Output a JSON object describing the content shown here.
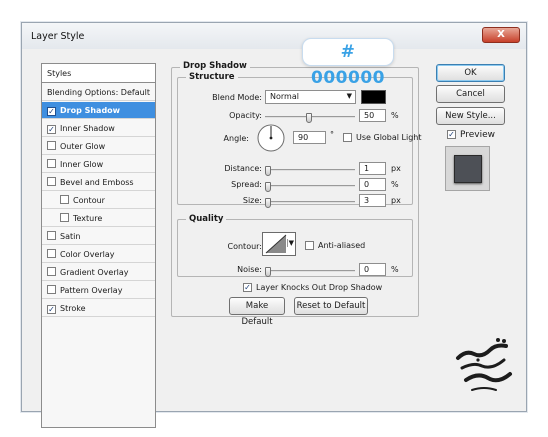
{
  "window": {
    "title": "Layer Style",
    "close_label": "X"
  },
  "color_tag": {
    "label": "# 000000"
  },
  "styles_panel": {
    "header": "Styles",
    "items": [
      {
        "label": "Blending Options: Default",
        "checkbox": false
      },
      {
        "label": "Drop Shadow",
        "checkbox": true,
        "checked": true,
        "active": true
      },
      {
        "label": "Inner Shadow",
        "checkbox": true,
        "checked": true
      },
      {
        "label": "Outer Glow",
        "checkbox": true,
        "checked": false
      },
      {
        "label": "Inner Glow",
        "checkbox": true,
        "checked": false
      },
      {
        "label": "Bevel and Emboss",
        "checkbox": true,
        "checked": false
      },
      {
        "label": "Contour",
        "checkbox": true,
        "checked": false,
        "sub": true
      },
      {
        "label": "Texture",
        "checkbox": true,
        "checked": false,
        "sub": true
      },
      {
        "label": "Satin",
        "checkbox": true,
        "checked": false
      },
      {
        "label": "Color Overlay",
        "checkbox": true,
        "checked": false
      },
      {
        "label": "Gradient Overlay",
        "checkbox": true,
        "checked": false
      },
      {
        "label": "Pattern Overlay",
        "checkbox": true,
        "checked": false
      },
      {
        "label": "Stroke",
        "checkbox": true,
        "checked": true
      }
    ]
  },
  "drop_shadow": {
    "title": "Drop Shadow",
    "structure": {
      "legend": "Structure",
      "blend_mode_label": "Blend Mode:",
      "blend_mode_value": "Normal",
      "shadow_color": "#000000",
      "opacity_label": "Opacity:",
      "opacity_value": "50",
      "opacity_unit": "%",
      "angle_label": "Angle:",
      "angle_value": "90",
      "angle_unit": "°",
      "use_global_light_label": "Use Global Light",
      "use_global_light": false,
      "distance_label": "Distance:",
      "distance_value": "1",
      "distance_unit": "px",
      "spread_label": "Spread:",
      "spread_value": "0",
      "spread_unit": "%",
      "size_label": "Size:",
      "size_value": "3",
      "size_unit": "px"
    },
    "quality": {
      "legend": "Quality",
      "contour_label": "Contour:",
      "anti_aliased_label": "Anti-aliased",
      "anti_aliased": false,
      "noise_label": "Noise:",
      "noise_value": "0",
      "noise_unit": "%"
    },
    "knockout_label": "Layer Knocks Out Drop Shadow",
    "knockout": true,
    "make_default_label": "Make Default",
    "reset_default_label": "Reset to Default"
  },
  "side_buttons": {
    "ok_label": "OK",
    "cancel_label": "Cancel",
    "new_style_label": "New Style...",
    "preview_label": "Preview",
    "preview_checked": true
  },
  "colors": {
    "accent": "#3f8fe0",
    "tag_text": "#3aa2e6",
    "preview_swatch": "#4d5056"
  },
  "watermark": {
    "icon": "calligraphic-logo-icon"
  }
}
